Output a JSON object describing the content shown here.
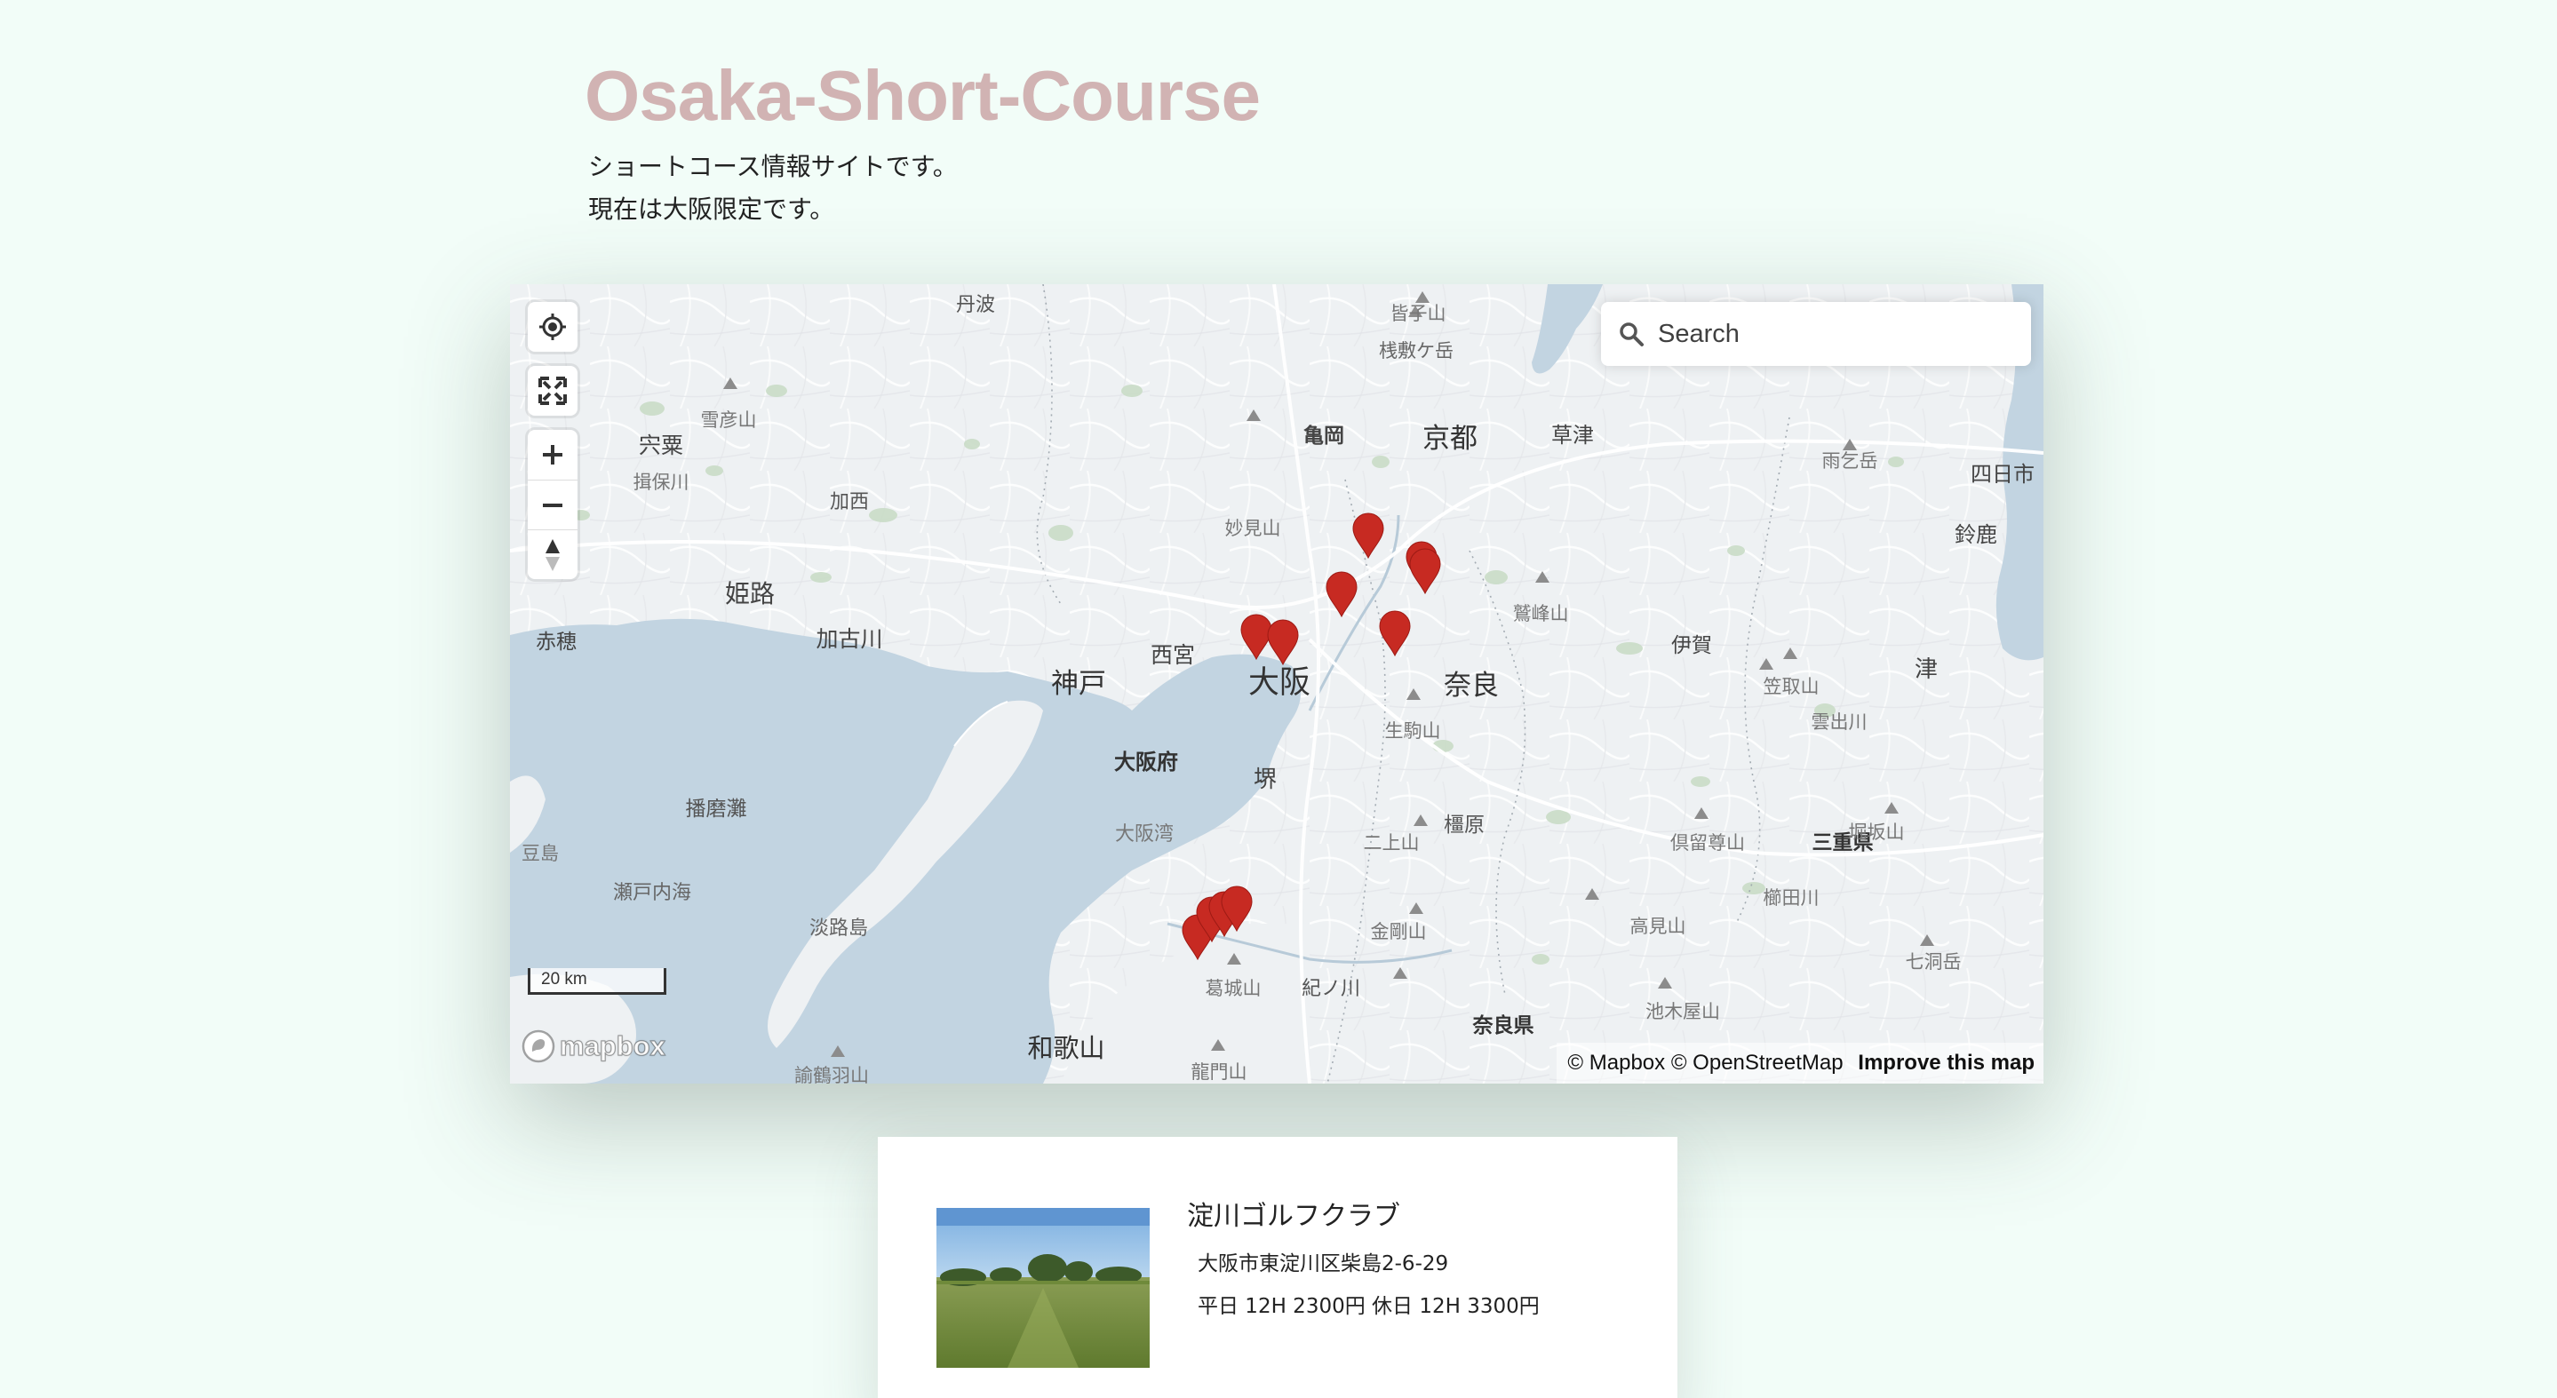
{
  "header": {
    "title": "Osaka-Short-Course",
    "intro_line1": "ショートコース情報サイトです。",
    "intro_line2": "現在は大阪限定です。"
  },
  "map": {
    "search_placeholder": "Search",
    "scale_label": "20 km",
    "logo_text": "mapbox",
    "attribution": {
      "mapbox": "© Mapbox",
      "osm": "© OpenStreetMap",
      "improve": "Improve this map"
    },
    "controls": [
      "geolocate-icon",
      "fullscreen-icon",
      "zoom-in-icon",
      "zoom-out-icon",
      "compass-icon"
    ],
    "marker_color": "#c72a22",
    "water_color": "#c2d4e1",
    "land_color": "#eef1f3",
    "park_color": "#c3d9bf",
    "labels": {
      "osaka": "大阪",
      "kobe": "神戸",
      "kyoto": "京都",
      "nara": "奈良",
      "wakayama": "和歌山",
      "himeji": "姫路",
      "nishinomiya": "西宮",
      "sakai": "堺",
      "kameoka": "亀岡",
      "kakogawa": "加古川",
      "kasai": "加西",
      "ako": "赤穂",
      "shiso": "宍粟",
      "ibogawa": "揖保川",
      "tamba": "丹波",
      "kusatsu": "草津",
      "yokkaichi": "四日市",
      "suzuka": "鈴鹿",
      "tsu": "津",
      "iga": "伊賀",
      "kashihara": "橿原",
      "osaka_pref": "大阪府",
      "mie_pref": "三重県",
      "nara_pref": "奈良県",
      "osaka_bay": "大阪湾",
      "harima_nada": "播磨灘",
      "seto_naikai": "瀬戸内海",
      "awajishima": "淡路島",
      "shodoshima": "豆島",
      "kinokawa": "紀ノ川",
      "myokensan": "妙見山",
      "ikomayama": "生駒山",
      "nijozan": "二上山",
      "kongosan": "金剛山",
      "katsuragisan": "葛城山",
      "ryumonzan": "龍門山",
      "washiminesan": "鷲峰山",
      "kasatoriyama": "笠取山",
      "kumosuyama": "雲出川",
      "kuruson": "倶留尊山",
      "takamisan": "高見山",
      "horisakayama": "堀坂山",
      "misugiyama": "櫛田川",
      "ikeshiyama": "池木屋山",
      "nanahoradake": "七洞岳",
      "amagoidake": "雨乞岳",
      "sekigaharasan": "皆子山",
      "sekigatake": "桟敷ケ岳",
      "yukihikosan": "雪彦山",
      "ugaku": "諭鶴羽山"
    }
  },
  "course": {
    "name": "淀川ゴルフクラブ",
    "address": "大阪市東淀川区柴島2-6-29",
    "price": "平日 12H 2300円 休日 12H 3300円",
    "photo": "golf-course-photo"
  }
}
